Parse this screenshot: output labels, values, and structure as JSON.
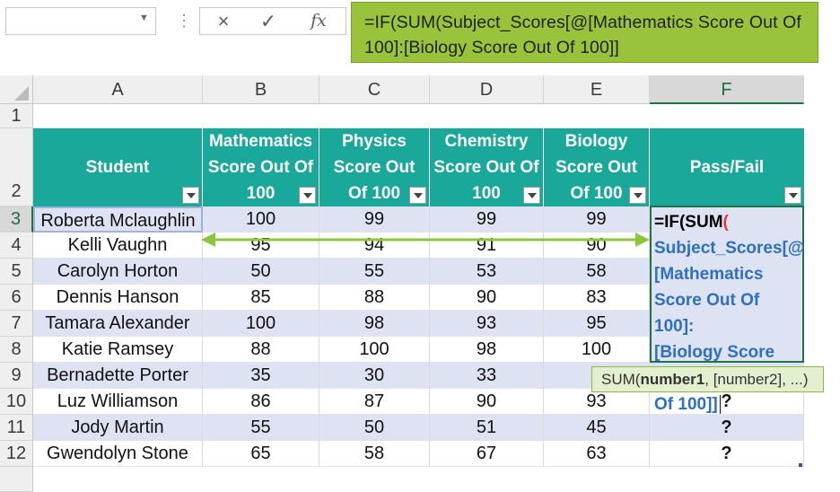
{
  "formula_bar": {
    "cancel_icon": "×",
    "enter_icon": "✓",
    "fx_label": "fx",
    "formula_line1": "=IF(SUM(Subject_Scores[@[Mathematics Score Out Of",
    "formula_line2": "100]:[Biology Score Out Of 100]]"
  },
  "columns": [
    "A",
    "B",
    "C",
    "D",
    "E",
    "F"
  ],
  "rows": [
    "1",
    "2",
    "3",
    "4",
    "5",
    "6",
    "7",
    "8",
    "9",
    "10",
    "11",
    "12"
  ],
  "table": {
    "headers": {
      "a": "Student",
      "b1": "Mathematics",
      "b2": "Score Out Of",
      "b3": "100",
      "c1": "Physics",
      "c2": "Score Out",
      "c3": "Of 100",
      "d1": "Chemistry",
      "d2": "Score Out Of",
      "d3": "100",
      "e1": "Biology",
      "e2": "Score Out",
      "e3": "Of 100",
      "f": "Pass/Fail"
    },
    "data": [
      {
        "student": "Roberta Mclaughlin",
        "math": "100",
        "physics": "99",
        "chem": "99",
        "bio": "99",
        "result": ""
      },
      {
        "student": "Kelli Vaughn",
        "math": "95",
        "physics": "94",
        "chem": "91",
        "bio": "90",
        "result": ""
      },
      {
        "student": "Carolyn Horton",
        "math": "50",
        "physics": "55",
        "chem": "53",
        "bio": "58",
        "result": ""
      },
      {
        "student": "Dennis Hanson",
        "math": "85",
        "physics": "88",
        "chem": "90",
        "bio": "83",
        "result": ""
      },
      {
        "student": "Tamara Alexander",
        "math": "100",
        "physics": "98",
        "chem": "93",
        "bio": "95",
        "result": ""
      },
      {
        "student": "Katie Ramsey",
        "math": "88",
        "physics": "100",
        "chem": "98",
        "bio": "100",
        "result": ""
      },
      {
        "student": "Bernadette Porter",
        "math": "35",
        "physics": "30",
        "chem": "33",
        "bio": "4",
        "result": ""
      },
      {
        "student": "Luz Williamson",
        "math": "86",
        "physics": "87",
        "chem": "90",
        "bio": "93",
        "result": "?"
      },
      {
        "student": "Jody Martin",
        "math": "55",
        "physics": "50",
        "chem": "51",
        "bio": "45",
        "result": "?"
      },
      {
        "student": "Gwendolyn Stone",
        "math": "65",
        "physics": "58",
        "chem": "67",
        "bio": "63",
        "result": "?"
      }
    ]
  },
  "edit_cell": {
    "l1a": "=IF(SUM",
    "l1b": "(",
    "l2": "Subject_Scores[@",
    "l3": "[Mathematics",
    "l4": "Score Out Of 100]:",
    "l5": "[Biology Score Out",
    "l6": "Of 100]]"
  },
  "tooltip": {
    "fn": "SUM(",
    "arg1": "number1",
    "rest": ", [number2], ...)"
  },
  "colors": {
    "header_teal": "#1aa89a",
    "band_blue": "#dde3f3",
    "formula_green": "#99c33a",
    "arrow_green": "#8cc63f"
  }
}
